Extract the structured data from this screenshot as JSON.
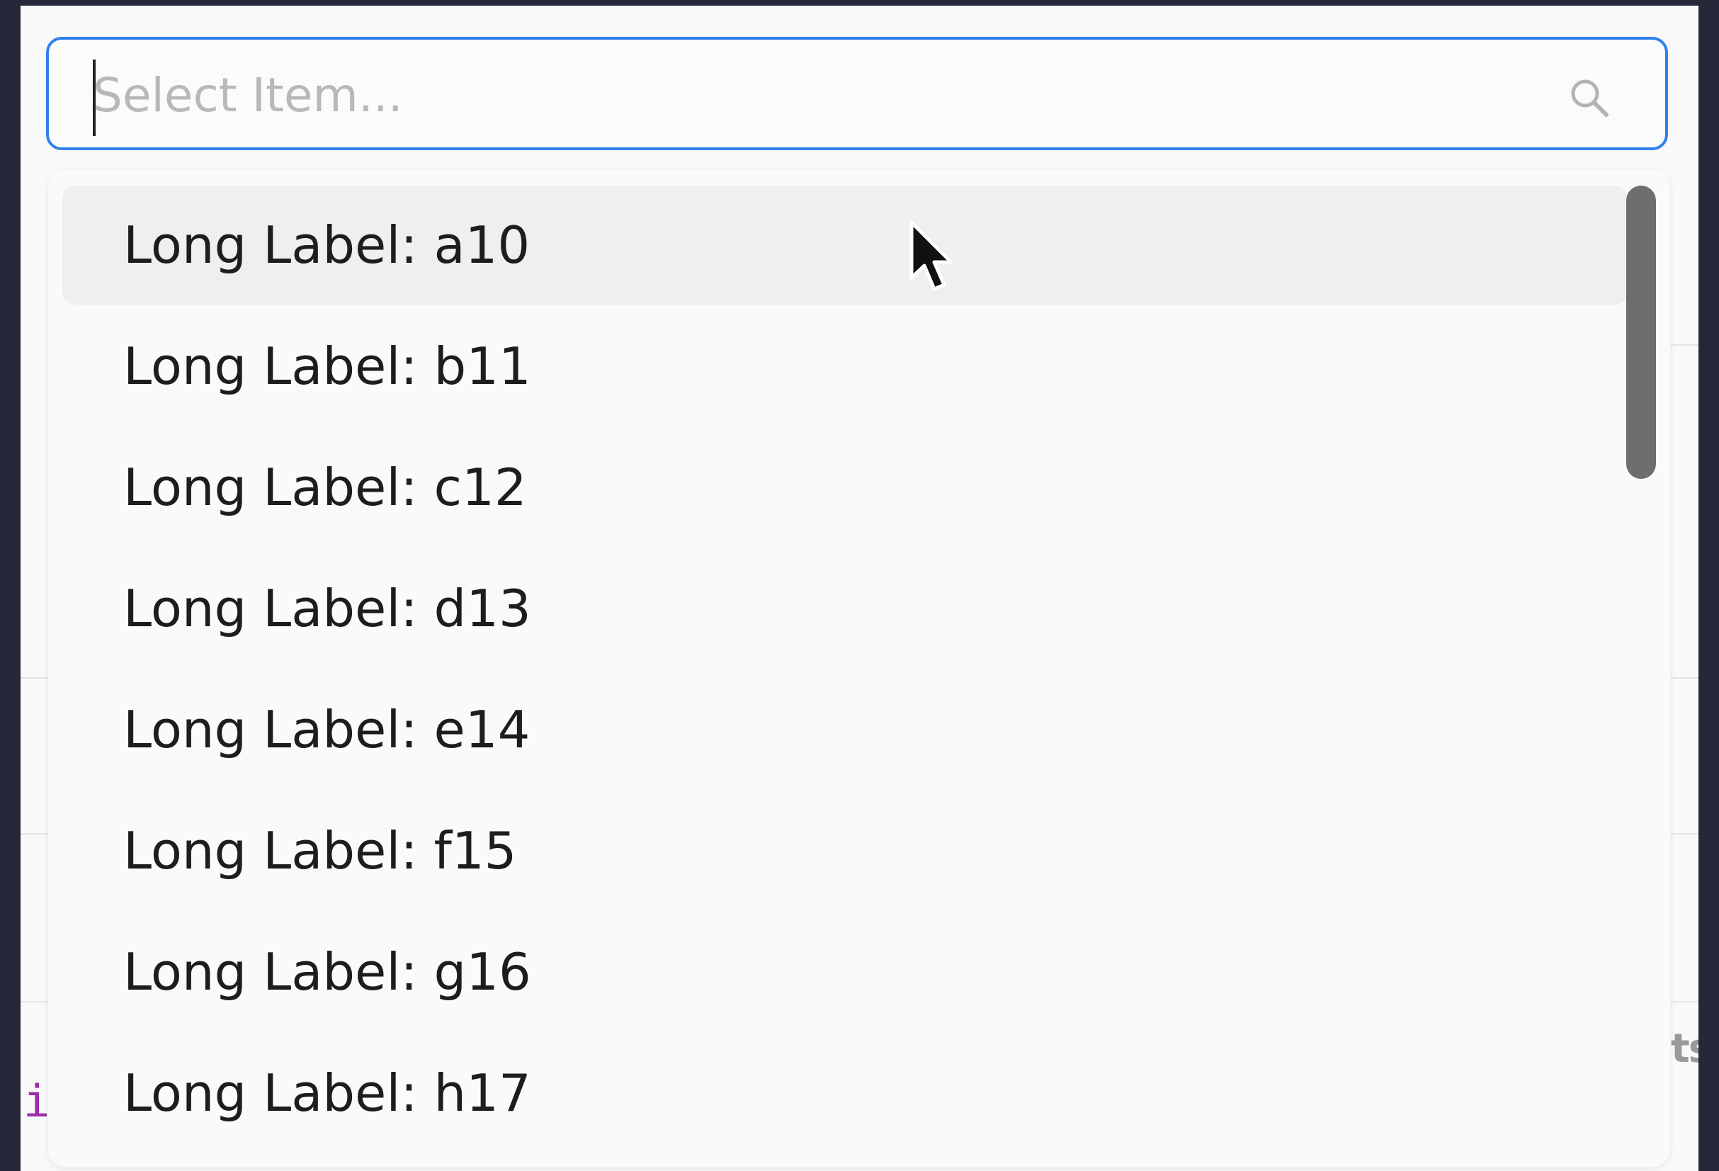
{
  "combobox": {
    "placeholder": "Select Item...",
    "value": "",
    "accent_color": "#2f80ed"
  },
  "search_icon": "search-icon",
  "dropdown": {
    "hovered_index": 0,
    "options": [
      {
        "label": "Long Label: a10"
      },
      {
        "label": "Long Label: b11"
      },
      {
        "label": "Long Label: c12"
      },
      {
        "label": "Long Label: d13"
      },
      {
        "label": "Long Label: e14"
      },
      {
        "label": "Long Label: f15"
      },
      {
        "label": "Long Label: g16"
      },
      {
        "label": "Long Label: h17"
      }
    ]
  },
  "background": {
    "fragment_text": "ts",
    "code_glyph": "i"
  },
  "colors": {
    "desktop": "#252838",
    "panel": "#fafafa",
    "hover": "#efefef",
    "scrollbar": "#6e6e6e"
  }
}
